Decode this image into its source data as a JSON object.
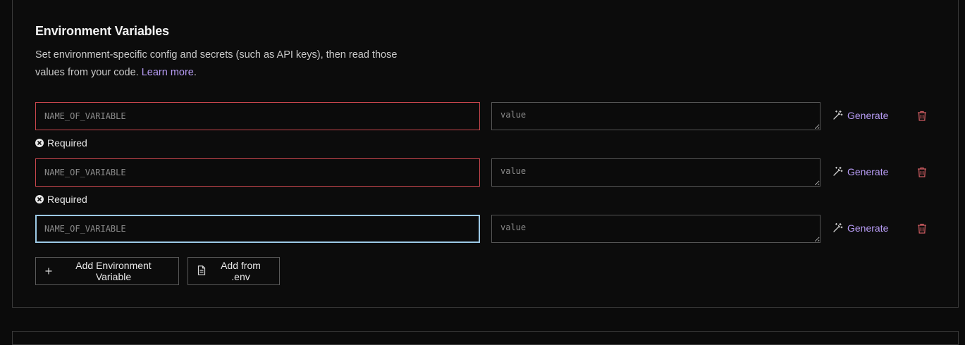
{
  "section": {
    "title": "Environment Variables",
    "description_line1": "Set environment-specific config and secrets (such as API keys), then read those",
    "description_line2": "values from your code.",
    "learn_more": "Learn more",
    "period": "."
  },
  "variables": [
    {
      "name_placeholder": "NAME_OF_VARIABLE",
      "value_placeholder": "value",
      "generate_label": "Generate",
      "error": "Required"
    },
    {
      "name_placeholder": "NAME_OF_VARIABLE",
      "value_placeholder": "value",
      "generate_label": "Generate",
      "error": "Required"
    },
    {
      "name_placeholder": "NAME_OF_VARIABLE",
      "value_placeholder": "value",
      "generate_label": "Generate"
    }
  ],
  "actions": {
    "add_variable_label": "Add Environment Variable",
    "add_from_env_label": "Add from .env"
  },
  "colors": {
    "accent": "#b79cf5",
    "error_border": "#c8464d",
    "focus_border": "#9cc9e6",
    "trash": "#c95a5f"
  },
  "icons": {
    "generate": "magic-wand-icon",
    "delete": "trash-icon",
    "error": "x-circle-icon",
    "add": "plus-icon",
    "file": "file-icon"
  }
}
